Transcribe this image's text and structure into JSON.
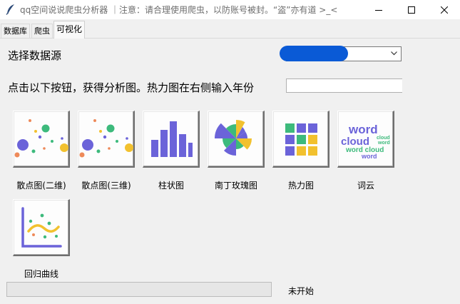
{
  "window": {
    "title": "qq空间说说爬虫分析器 ｜注意：请合理使用爬虫，以防账号被封。“盗”亦有道 >_<",
    "icons": {
      "app": "feather-icon",
      "minimize": "minimize-icon",
      "maximize": "maximize-icon",
      "close": "close-icon"
    }
  },
  "tabs": [
    {
      "label": "数据库",
      "active": false
    },
    {
      "label": "爬虫",
      "active": false
    },
    {
      "label": "可视化",
      "active": true
    }
  ],
  "source": {
    "label": "选择数据源",
    "selected": "",
    "redaction_color": "#0a5ad6"
  },
  "instruction": {
    "label": "点击以下按钮，获得分析图。热力图在右侧输入年份",
    "year_value": ""
  },
  "chart_buttons": [
    {
      "caption": "散点图(二维)",
      "icon": "scatter-2d-icon"
    },
    {
      "caption": "散点图(三维)",
      "icon": "scatter-3d-icon"
    },
    {
      "caption": "柱状图",
      "icon": "bar-chart-icon"
    },
    {
      "caption": "南丁玫瑰图",
      "icon": "nightingale-rose-icon"
    },
    {
      "caption": "热力图",
      "icon": "heatmap-icon"
    },
    {
      "caption": "词云",
      "icon": "word-cloud-icon",
      "words": [
        "word",
        "cloud",
        "cloud",
        "word",
        "word cloud",
        "word"
      ]
    },
    {
      "caption": "回归曲线",
      "icon": "regression-curve-icon"
    }
  ],
  "progress": {
    "value": 0
  },
  "status": "未开始",
  "colors": {
    "purple": "#6b63d9",
    "green": "#3dba7c",
    "yellow": "#f2c12e",
    "orange": "#ee8a5a",
    "progress_fill": "#06b025"
  }
}
